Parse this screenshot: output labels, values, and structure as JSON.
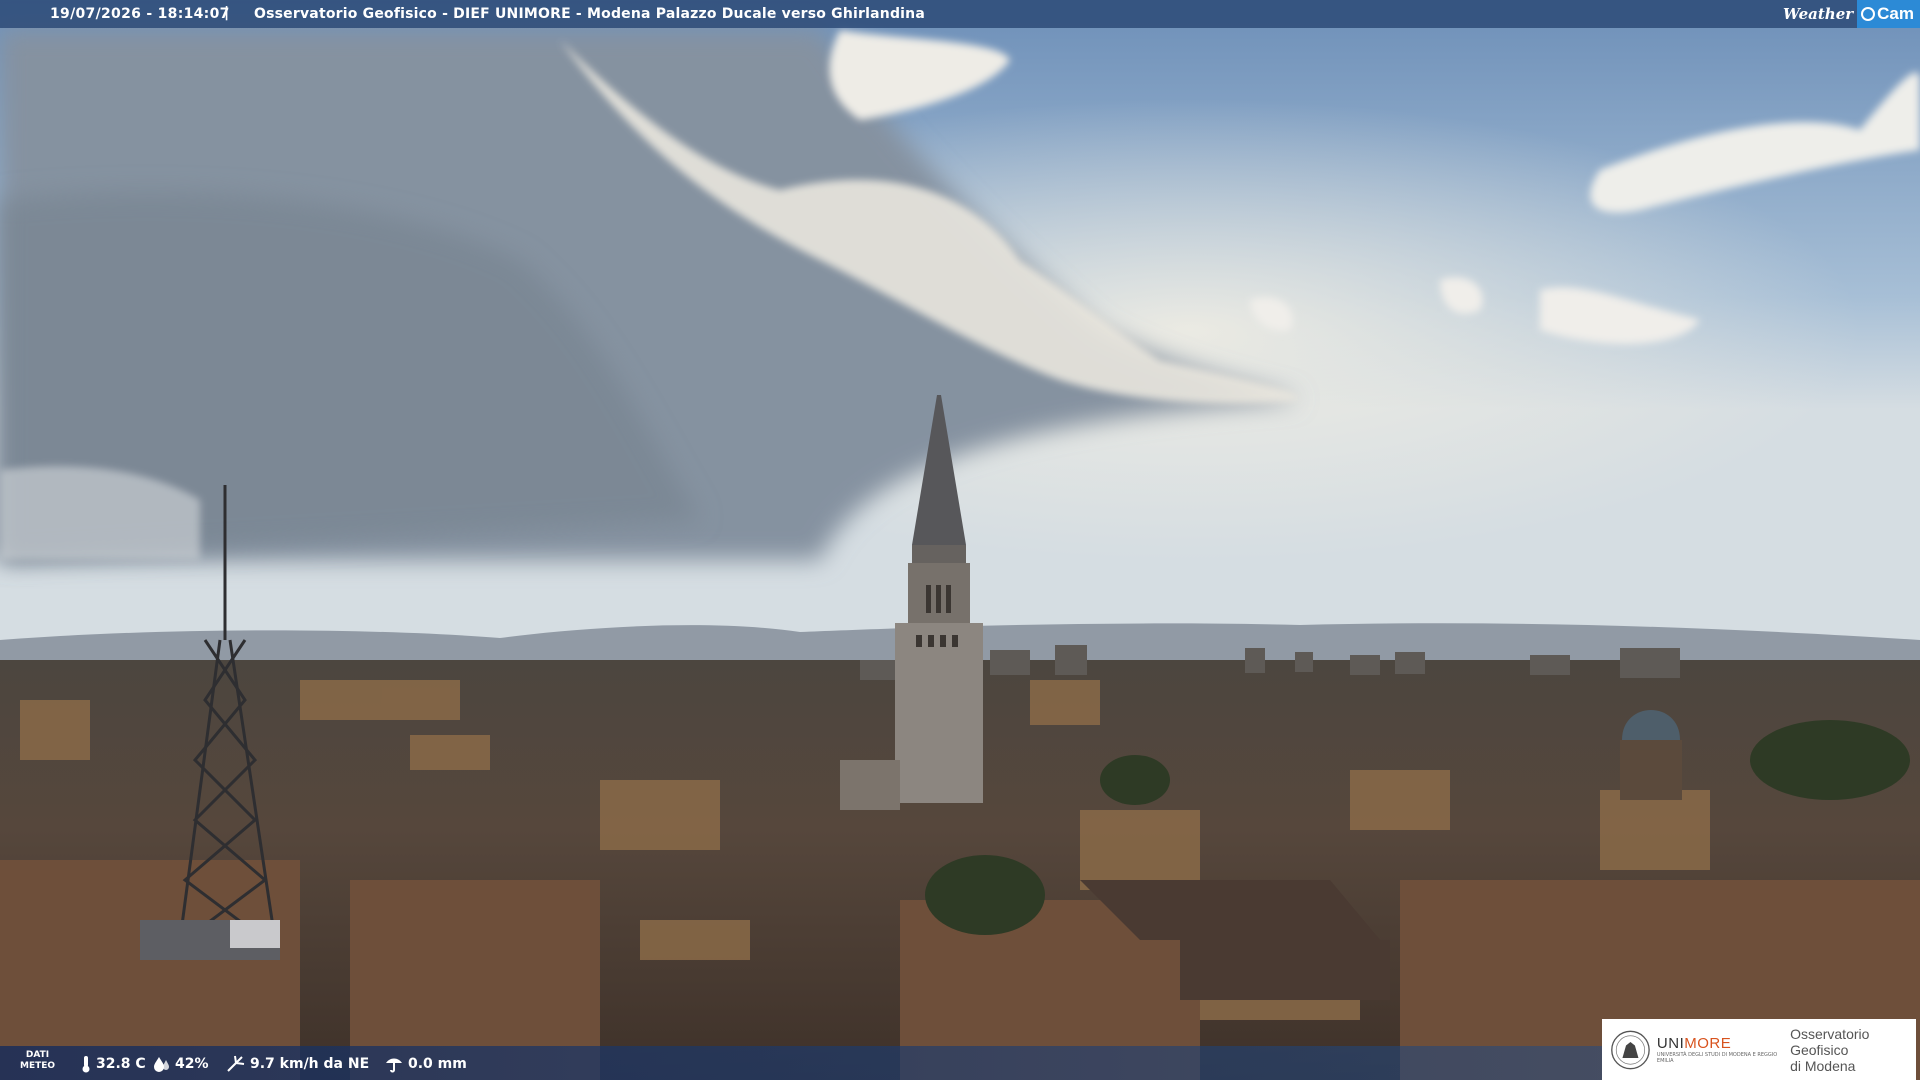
{
  "overlay": {
    "timestamp": "19/07/2026 - 18:14:07",
    "separator": "|",
    "title": "Osservatorio Geofisico - DIEF UNIMORE - Modena Palazzo Ducale verso Ghirlandina",
    "brand_weather": "Weather",
    "brand_cam": "Cam"
  },
  "weather": {
    "label_line1": "DATI",
    "label_line2": "METEO",
    "temperature": "32.8 C",
    "humidity": "42%",
    "wind": "9.7 km/h da NE",
    "rain": "0.0 mm",
    "icons": [
      "thermometer-icon",
      "humidity-drop-icon",
      "wind-icon",
      "rain-gauge-icon"
    ]
  },
  "logo": {
    "uni_prefix": "UNI",
    "uni_suffix": "MORE",
    "uni_subtitle": "UNIVERSITÀ DEGLI STUDI DI MODENA E REGGIO EMILIA",
    "observatory_line1": "Osservatorio Geofisico",
    "observatory_line2": "di Modena",
    "accent_color": "#d8531e"
  },
  "scene": {
    "description_colors": {
      "sky": "#a9bdd2",
      "roofs": "#4a3a30"
    }
  }
}
